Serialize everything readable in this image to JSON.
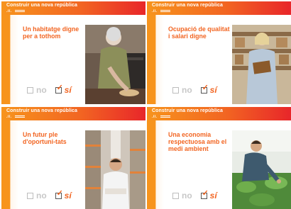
{
  "campaign": "Construir una nova república",
  "logo_mark": ".íí.",
  "options": {
    "no": "no",
    "si": "sí"
  },
  "cards": [
    {
      "headline": "Un habitatge digne per a tothom"
    },
    {
      "headline": "Ocupació de qualitat i salari digne"
    },
    {
      "headline": "Un futur ple d'oportuni-tats"
    },
    {
      "headline": "Una economia respectuosa amb el medi ambient"
    }
  ],
  "colors": {
    "accent": "#f26522",
    "orange": "#f7941d",
    "red": "#e8262a"
  }
}
